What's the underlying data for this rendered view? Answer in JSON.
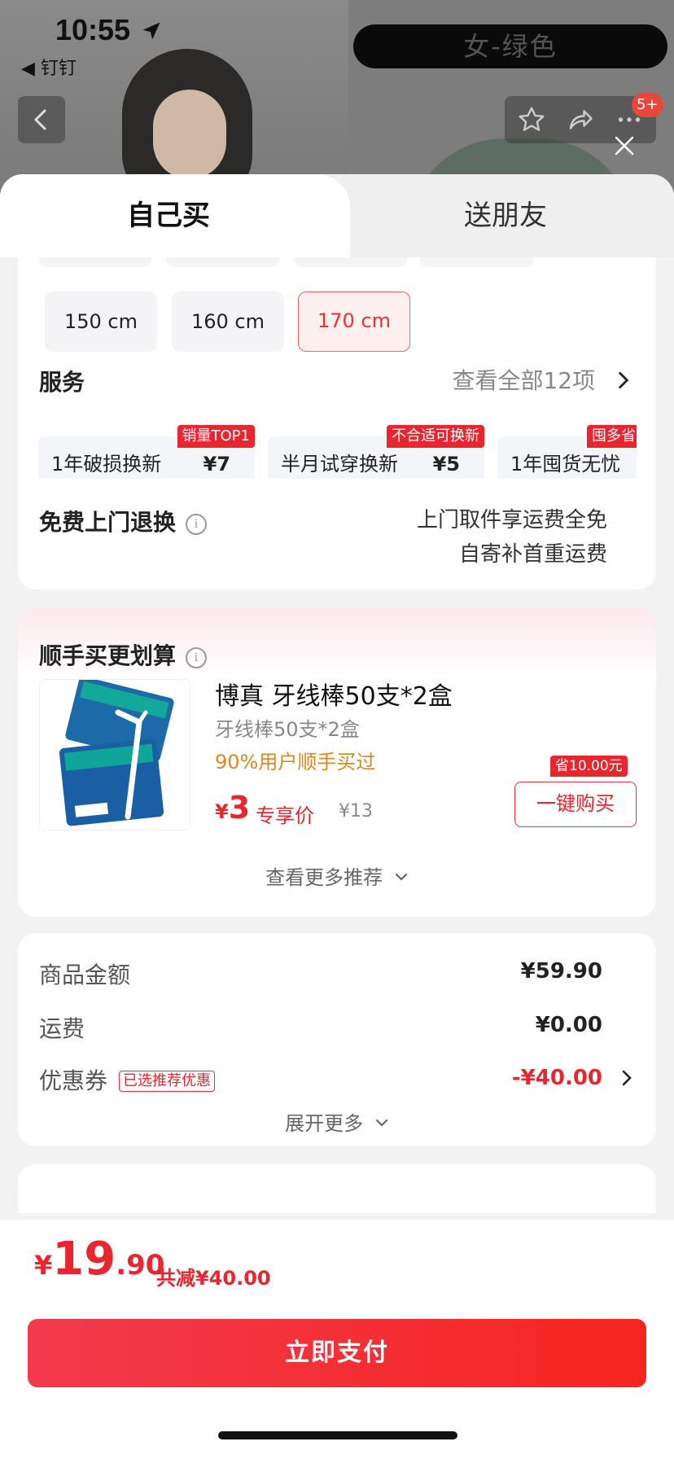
{
  "status_bar": {
    "time": "10:55",
    "back_app": "◀ 钉钉"
  },
  "product_page": {
    "selected_variant": "女-绿色",
    "badge_count": "5+"
  },
  "tabs": [
    {
      "label": "自己买"
    },
    {
      "label": "送朋友"
    }
  ],
  "sizes": [
    {
      "label": "150 cm"
    },
    {
      "label": "160 cm"
    },
    {
      "label": "170 cm",
      "selected": true
    }
  ],
  "services": {
    "title": "服务",
    "view_all": "查看全部12项",
    "items": [
      {
        "name": "1年破损换新",
        "price": "¥7",
        "tag": "销量TOP1"
      },
      {
        "name": "半月试穿换新",
        "price": "¥5",
        "tag": "不合适可换新"
      },
      {
        "name": "1年囤货无忧",
        "tag": "囤多省"
      }
    ]
  },
  "free_return": {
    "title": "免费上门退换",
    "desc1": "上门取件享运费全免",
    "desc2": "自寄补首重运费"
  },
  "addon": {
    "title": "顺手买更划算",
    "product_name": "博真 牙线棒50支*2盒",
    "spec": "牙线棒50支*2盒",
    "popularity": "90%用户顺手买过",
    "price_currency": "¥",
    "price": "3",
    "price_label": "专享价",
    "original_price": "¥13",
    "save_tag": "省10.00元",
    "buy_label": "一键购买",
    "see_more": "查看更多推荐"
  },
  "summary": {
    "goods_label": "商品金额",
    "goods_value": "¥59.90",
    "shipping_label": "运费",
    "shipping_value": "¥0.00",
    "coupon_label": "优惠券",
    "coupon_tag": "已选推荐优惠",
    "coupon_value": "-¥40.00",
    "expand": "展开更多"
  },
  "footer": {
    "currency": "¥",
    "total_int": "19",
    "total_dec": ".90",
    "saved": "共减¥40.00",
    "pay_label": "立即支付"
  },
  "colors": {
    "accent": "#e8262f",
    "pay_start": "#f23a4d",
    "pay_end": "#f6251f"
  }
}
